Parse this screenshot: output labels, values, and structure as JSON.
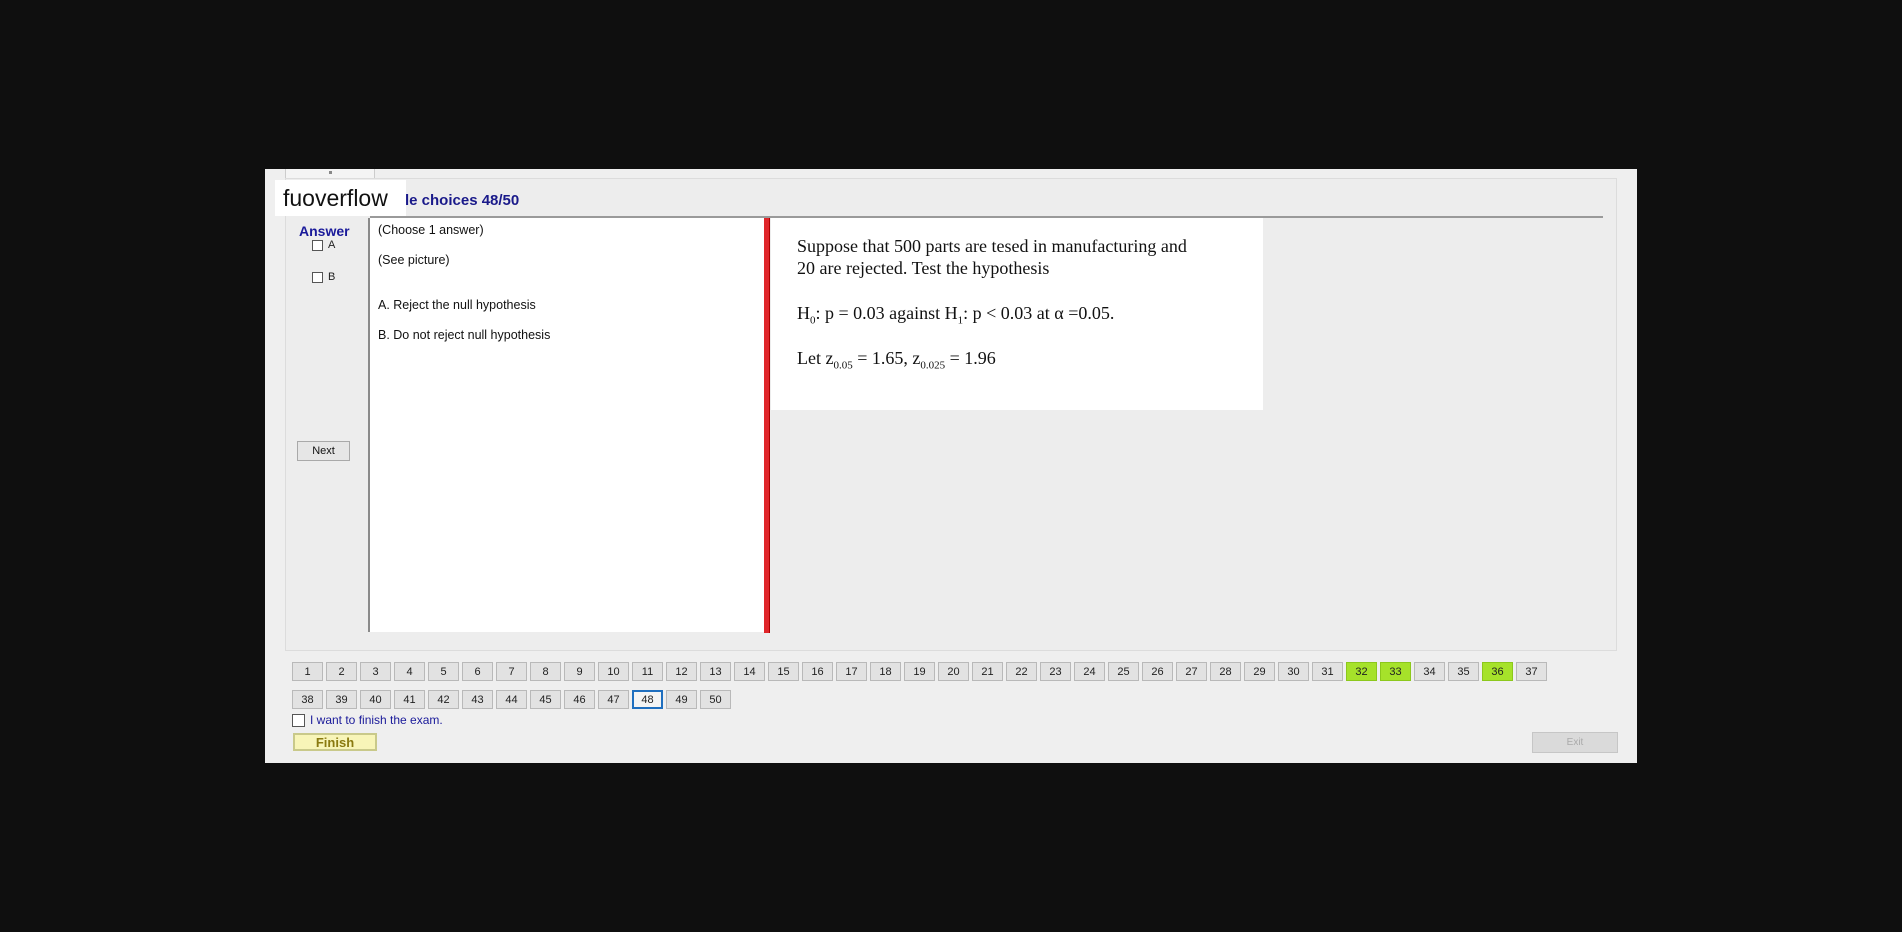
{
  "watermark": "fuoverflow",
  "header": {
    "title": "le choices 48/50"
  },
  "answer": {
    "label": "Answer",
    "options": [
      "A",
      "B"
    ],
    "next_label": "Next"
  },
  "question_text": {
    "instruction": "(Choose 1 answer)",
    "see_picture": "(See picture)",
    "choices": [
      "A.  Reject the null hypothesis",
      "B.  Do not reject null hypothesis"
    ]
  },
  "picture": {
    "line1": "Suppose that 500 parts are tesed in manufacturing and",
    "line2": "20 are rejected. Test the hypothesis",
    "h0_prefix": "H",
    "h0_sub": "0",
    "h0_mid": ": p = 0.03 against H",
    "h1_sub": "1",
    "h1_rest": ": p < 0.03 at α =0.05.",
    "z_prefix": "Let z",
    "z1_sub": "0.05",
    "z1_rest": " = 1.65, z",
    "z2_sub": "0.025",
    "z2_rest": " = 1.96"
  },
  "questions": {
    "row1": [
      "1",
      "2",
      "3",
      "4",
      "5",
      "6",
      "7",
      "8",
      "9",
      "10",
      "11",
      "12",
      "13",
      "14",
      "15",
      "16",
      "17",
      "18",
      "19",
      "20",
      "21",
      "22",
      "23",
      "24",
      "25",
      "26",
      "27",
      "28",
      "29",
      "30",
      "31",
      "32",
      "33",
      "34",
      "35",
      "36",
      "37"
    ],
    "row2": [
      "38",
      "39",
      "40",
      "41",
      "42",
      "43",
      "44",
      "45",
      "46",
      "47",
      "48",
      "49",
      "50"
    ],
    "answered": [
      "32",
      "33",
      "36"
    ],
    "current": "48"
  },
  "footer": {
    "finish_checkbox_label": "I want to finish the exam.",
    "finish_button": "Finish",
    "exit_button": "Exit"
  },
  "colors": {
    "answered": "#a6e22a",
    "current_border": "#1f6fbf",
    "divider": "#e0262a"
  }
}
